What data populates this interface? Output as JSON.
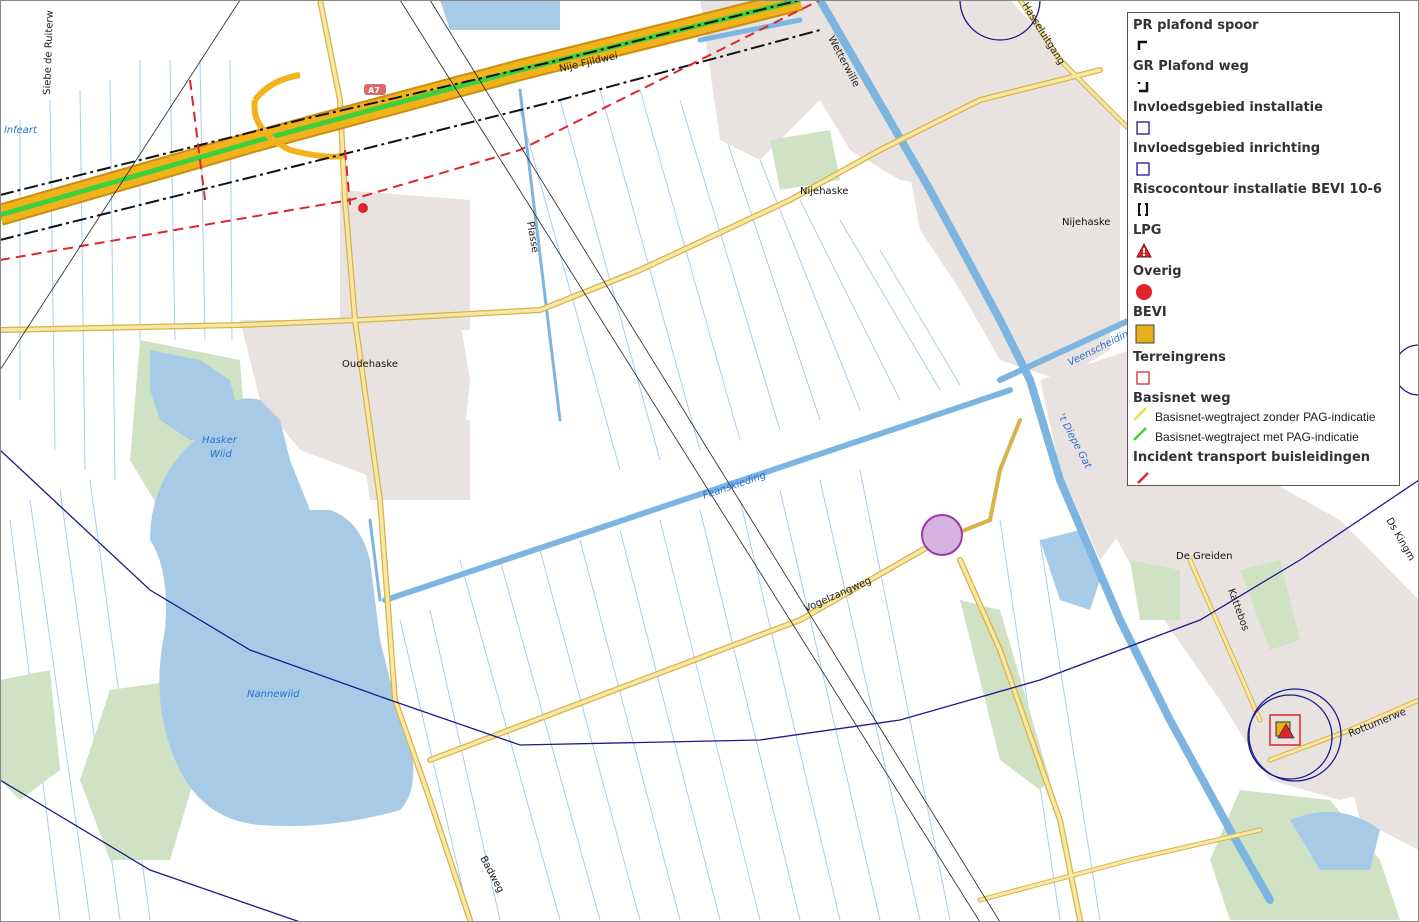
{
  "map": {
    "labels": {
      "siebe": "Siebe de Ruiterw",
      "nije_fjildwei": "Nije Fjildwei",
      "a7": "A7",
      "wetterwille": "Wetterwille",
      "heuteliegang": "Hasseluitgang",
      "nijehaske1": "Nijehaske",
      "nijehaske2": "Nijehaske",
      "plasse": "Plasse",
      "oudehaske": "Oudehaske",
      "hasker_wiid_1": "Hasker",
      "hasker_wiid_2": "Wiid",
      "nannewiid": "Nannewiid",
      "feanskieding": "Feanskieding",
      "vogelzangweg": "Vogelzangweg",
      "veenscheiding": "Veenscheiding",
      "diepe_gat": "'t Diepe Gat",
      "de_greiden": "De Greiden",
      "kattebos": "Kattebos",
      "rottumerweg": "Rottumerwe",
      "badweg": "Badweg",
      "ds_kingma": "Ds Kingm",
      "lnfeart": "lnfeart"
    },
    "colors": {
      "water": "#a7cbe6",
      "canal": "#7cb5e0",
      "road_yellow": "#f3df8a",
      "road_outline": "#d8b24a",
      "motorway": "#f2b21c",
      "green_route": "#3cd13c",
      "built": "#e8e3e0",
      "green_area": "#cfe3c4",
      "risk_line": "#1a1a8c",
      "incident_red": "#e0242c"
    }
  },
  "legend": {
    "pr_plafond_spoor": "PR plafond spoor",
    "gr_plafond_weg": "GR Plafond weg",
    "invloed_installatie": "Invloedsgebied installatie",
    "invloed_inrichting": "Invloedsgebied inrichting",
    "riscocontour": "Riscocontour installatie BEVI 10-6",
    "lpg": "LPG",
    "overig": "Overig",
    "bevi": "BEVI",
    "terreingrens": "Terreingrens",
    "basisnet_weg": "Basisnet weg",
    "zonder_pag": "Basisnet-wegtraject zonder PAG-indicatie",
    "met_pag": "Basisnet-wegtraject met PAG-indicatie",
    "incident": "Incident transport buisleidingen"
  }
}
